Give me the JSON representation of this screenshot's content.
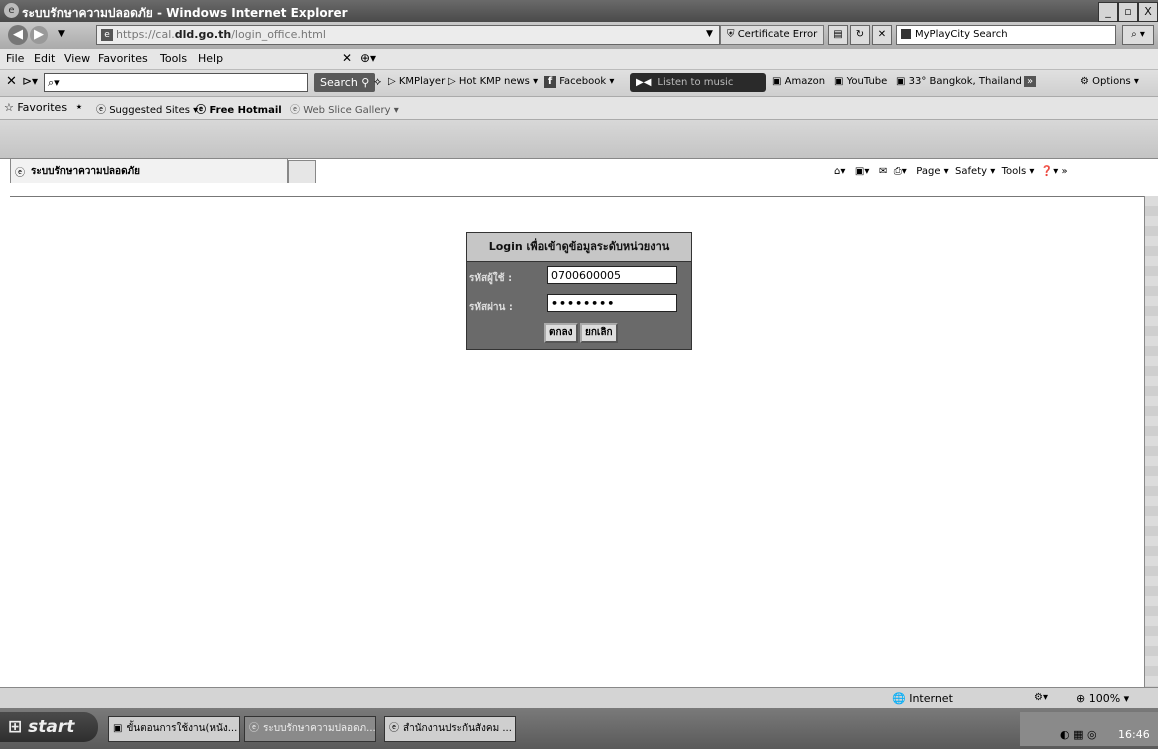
{
  "window": {
    "title": "ระบบรักษาความปลอดภัย - Windows Internet Explorer",
    "controls": [
      "_",
      "▫",
      "X"
    ]
  },
  "address_bar": {
    "url_prefix": "https://cal.",
    "url_domain": "dld.go.th",
    "url_path": "/login_office.html",
    "certificate": "Certificate Error",
    "search_placeholder": "MyPlayCity Search"
  },
  "menu": [
    "File",
    "Edit",
    "View",
    "Favorites",
    "Tools",
    "Help"
  ],
  "toolbar": {
    "search_button": "Search",
    "items": [
      "KMPlayer",
      "Hot KMP news ▾",
      "Facebook ▾",
      "Amazon",
      "YouTube",
      "33° Bangkok, Thailand ▾"
    ],
    "listen_label": "Listen to music",
    "options": "Options ▾"
  },
  "favorites_bar": {
    "favorites": "Favorites",
    "items": [
      "Suggested Sites ▾",
      "Free Hotmail",
      "Web Slice Gallery ▾"
    ]
  },
  "tab": {
    "label": "ระบบรักษาความปลอดภัย"
  },
  "command_bar": [
    "Page ▾",
    "Safety ▾",
    "Tools ▾"
  ],
  "login": {
    "title": "Login เพื่อเข้าดูข้อมูลระดับหน่วยงาน",
    "user_label": "รหัสผู้ใช้ :",
    "user_value": "0700600005",
    "pass_label": "รหัสผ่าน :",
    "pass_value": "••••••••",
    "ok_button": "ตกลง",
    "cancel_button": "ยกเลิก"
  },
  "status_bar": {
    "zone": "Internet",
    "zoom": "100%"
  },
  "taskbar": {
    "start": "start",
    "tasks": [
      "ขั้นตอนการใช้งาน(หนัง...",
      "ระบบรักษาความปลอดภ...",
      "สำนักงานประกันสังคม ..."
    ],
    "clock": "16:46"
  },
  "colors": {
    "chrome_dark": "#4a4a4a",
    "login_panel": "#6a6a6a",
    "login_header": "#c6c6c6"
  }
}
